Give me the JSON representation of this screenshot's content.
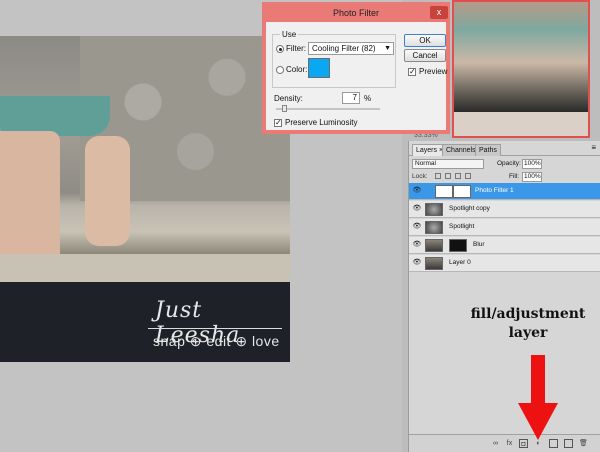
{
  "dialog": {
    "title": "Photo Filter",
    "close_label": "x",
    "use_label": "Use",
    "filter_label": "Filter:",
    "filter_value": "Cooling Filter (82)",
    "color_label": "Color:",
    "color_hex": "#0aa7f2",
    "density_label": "Density:",
    "density_value": "7",
    "density_unit": "%",
    "preserve_label": "Preserve Luminosity",
    "preserve_checked": true,
    "ok_label": "OK",
    "cancel_label": "Cancel",
    "preview_label": "Preview",
    "preview_checked": true
  },
  "navigator": {
    "zoom": "33.33%"
  },
  "photo": {
    "watermark_script": "Just Leesha",
    "watermark_tag": "snap ⊕ edit ⊕ love"
  },
  "layers_panel": {
    "tabs": [
      "Layers ×",
      "Channels",
      "Paths"
    ],
    "blend_mode": "Normal",
    "opacity_label": "Opacity:",
    "opacity_value": "100%",
    "lock_label": "Lock:",
    "fill_label": "Fill:",
    "fill_value": "100%",
    "layers": [
      {
        "name": "Photo Filter 1",
        "selected": true
      },
      {
        "name": "Spotlight copy",
        "selected": false
      },
      {
        "name": "Spotlight",
        "selected": false
      },
      {
        "name": "Blur",
        "selected": false
      },
      {
        "name": "Layer 0",
        "selected": false
      }
    ]
  },
  "annotation": {
    "line1": "fill/adjustment",
    "line2": "layer",
    "arrow_color": "#ee1111"
  }
}
